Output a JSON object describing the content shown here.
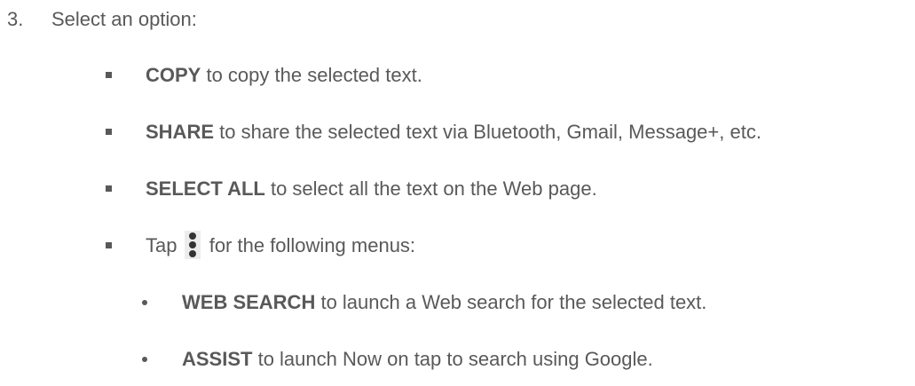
{
  "step": {
    "number": "3.",
    "text": "Select an option:"
  },
  "options": [
    {
      "keyword": "COPY",
      "desc": " to copy the selected text."
    },
    {
      "keyword": "SHARE",
      "desc": " to share the selected text via Bluetooth, Gmail, Message+, etc."
    },
    {
      "keyword": "SELECT ALL",
      "desc": " to select all the text on the Web page."
    }
  ],
  "tap": {
    "prefix": "Tap ",
    "icon": "more-vert-icon",
    "suffix": " for the following menus:"
  },
  "submenus": [
    {
      "keyword": "WEB SEARCH",
      "desc": " to launch a Web search for the selected text."
    },
    {
      "keyword": "ASSIST",
      "desc": " to launch Now on tap to search using Google."
    }
  ]
}
